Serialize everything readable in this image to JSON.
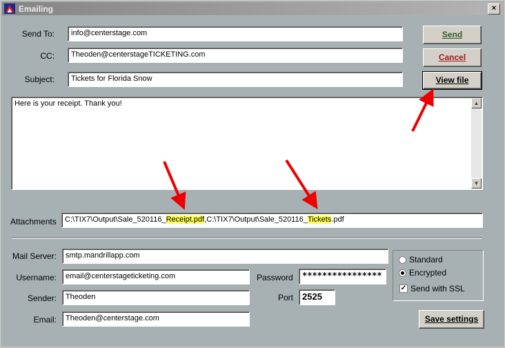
{
  "window": {
    "title": "Emailing",
    "close_label": "×"
  },
  "labels": {
    "send_to": "Send To:",
    "cc": "CC:",
    "subject": "Subject:",
    "attachments": "Attachments",
    "mail_server": "Mail Server:",
    "username": "Username:",
    "sender": "Sender:",
    "email": "Email:",
    "password": "Password",
    "port": "Port"
  },
  "fields": {
    "send_to": "info@centerstage.com",
    "cc": "Theoden@centerstageTICKETING.com",
    "subject": "Tickets for Florida Snow",
    "body": "Here is your receipt. Thank you!",
    "attachments": {
      "part1": "C:\\TIX7\\Output\\Sale_520116_",
      "receipt": "Receipt.pdf",
      "part2": ",C:\\TIX7\\Output\\Sale_520116_",
      "tickets": "Tickets",
      "part3": ".pdf"
    },
    "mail_server": "smtp.mandrillapp.com",
    "username": "email@centerstageticketing.com",
    "sender": "Theoden",
    "email": "Theoden@centerstage.com",
    "password": "****************",
    "port": "2525"
  },
  "buttons": {
    "send": "Send",
    "cancel": "Cancel",
    "view_file": "View file",
    "save_settings": "Save settings"
  },
  "options": {
    "standard": "Standard",
    "encrypted": "Encrypted",
    "selected": "Encrypted",
    "ssl": "Send with SSL",
    "ssl_checked": true
  },
  "colors": {
    "arrow": "#ee0000",
    "highlight": "#ffff55"
  }
}
